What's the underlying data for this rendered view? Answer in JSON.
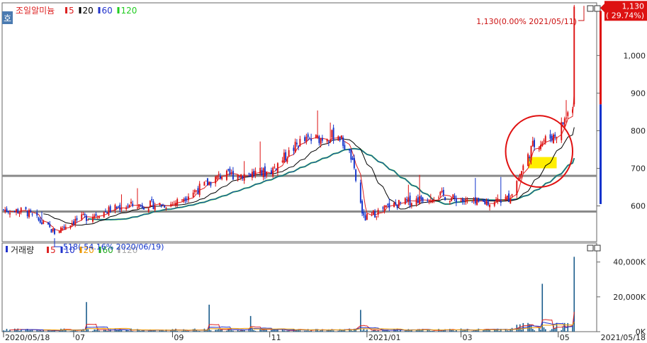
{
  "chart_data": [
    {
      "type": "candlestick",
      "title": "조일알미늄",
      "legend": [
        {
          "label": "5",
          "color": "#dd2222"
        },
        {
          "label": "20",
          "color": "#000000"
        },
        {
          "label": "60",
          "color": "#2233cc"
        },
        {
          "label": "120",
          "color": "#22cc22"
        }
      ],
      "y_ticks": [
        600,
        700,
        800,
        900,
        1000
      ],
      "y_tick_labels": [
        "600",
        "700",
        "800",
        "900",
        "1,000"
      ],
      "ylim": [
        505,
        1140
      ],
      "date_range": [
        "2020/05/18",
        "2021/05/18"
      ],
      "x_tick_labels": [
        "2020/05/18",
        "07",
        "09",
        "11",
        "2021/01",
        "03",
        "05"
      ],
      "x_end_label": "2021/05/18",
      "last_price": {
        "value": 1130,
        "label": "1,130",
        "change_label": "( 29.74%)"
      },
      "high_annotation": {
        "value": 1130,
        "text": "1,130(0.00% 2021/05/11)"
      },
      "low_annotation": {
        "value": 518,
        "text": "518(-54.16% 2020/06/19)"
      },
      "horizontal_lines": [
        680,
        585
      ],
      "highlight_zone": {
        "from": "2021/04/12",
        "to": "2021/04/30",
        "low": 700,
        "high": 730
      },
      "circle_annotation": {
        "from": "2021/03/29",
        "to": "2021/05/10",
        "low": 650,
        "high": 840
      },
      "key_prices": [
        {
          "date": "2020/05/18",
          "close": 590
        },
        {
          "date": "2020/06/01",
          "close": 585
        },
        {
          "date": "2020/06/19",
          "close": 530
        },
        {
          "date": "2020/07/01",
          "close": 560
        },
        {
          "date": "2020/08/01",
          "close": 600
        },
        {
          "date": "2020/09/01",
          "close": 605
        },
        {
          "date": "2020/10/01",
          "close": 680
        },
        {
          "date": "2020/11/01",
          "close": 690
        },
        {
          "date": "2020/11/20",
          "close": 770
        },
        {
          "date": "2020/12/14",
          "close": 790
        },
        {
          "date": "2020/12/22",
          "close": 730
        },
        {
          "date": "2020/12/30",
          "close": 565
        },
        {
          "date": "2021/01/15",
          "close": 600
        },
        {
          "date": "2021/02/15",
          "close": 630
        },
        {
          "date": "2021/03/10",
          "close": 605
        },
        {
          "date": "2021/03/31",
          "close": 620
        },
        {
          "date": "2021/04/15",
          "close": 760
        },
        {
          "date": "2021/04/30",
          "close": 790
        },
        {
          "date": "2021/05/10",
          "close": 870
        },
        {
          "date": "2021/05/11",
          "close": 1130
        }
      ]
    },
    {
      "type": "bar",
      "title": "거래량",
      "legend": [
        {
          "label": "5",
          "color": "#dd2222"
        },
        {
          "label": "10",
          "color": "#2233cc"
        },
        {
          "label": "20",
          "color": "#ee9900"
        },
        {
          "label": "60",
          "color": "#22aa22"
        },
        {
          "label": "120",
          "color": "#aaaaaa"
        }
      ],
      "y_ticks": [
        0,
        20000,
        40000
      ],
      "y_tick_labels": [
        "0K",
        "20,000K",
        "40,000K"
      ],
      "ylim": [
        0,
        46000
      ],
      "spikes": [
        {
          "date": "2020/07/09",
          "volume": 17000
        },
        {
          "date": "2020/09/24",
          "volume": 15500
        },
        {
          "date": "2020/10/20",
          "volume": 9000
        },
        {
          "date": "2020/12/28",
          "volume": 12500
        },
        {
          "date": "2021/04/21",
          "volume": 27500
        },
        {
          "date": "2021/05/11",
          "volume": 43000
        }
      ]
    }
  ]
}
